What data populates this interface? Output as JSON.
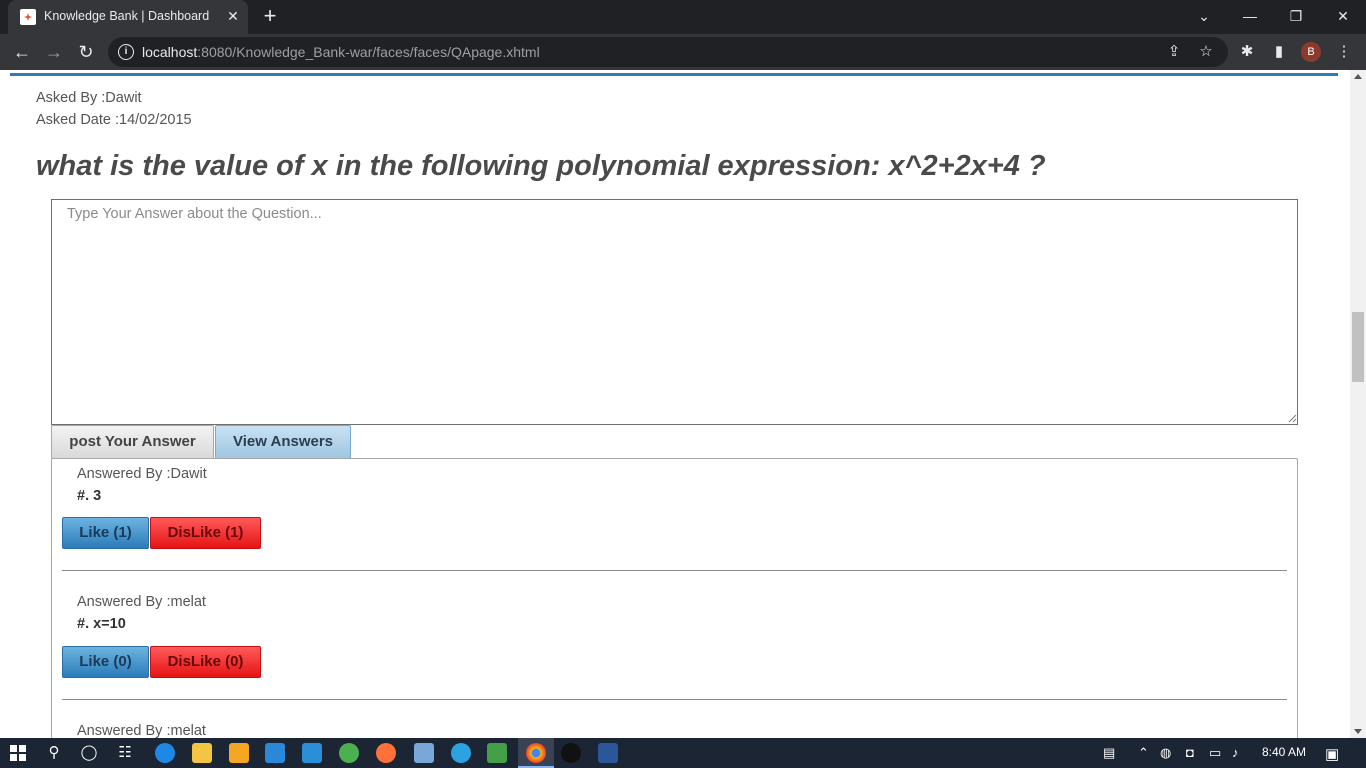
{
  "browser": {
    "tab_title": "Knowledge Bank | Dashboard",
    "tab_close": "✕",
    "new_tab": "+",
    "url_host": "localhost",
    "url_path": ":8080/Knowledge_Bank-war/faces/faces/QApage.xhtml",
    "profile_initial": "B",
    "window_controls": {
      "dropdown": "⌄",
      "minimize": "—",
      "restore": "❐",
      "close": "✕"
    }
  },
  "question": {
    "asked_by": "Asked By :Dawit",
    "asked_date": "Asked Date :14/02/2015",
    "text": "what is the value of x in the following polynomial expression: x^2+2x+4 ?"
  },
  "answer_form": {
    "placeholder": "Type Your Answer about the Question...",
    "post_label": "post Your Answer",
    "view_label": "View Answers"
  },
  "answers": [
    {
      "answered_by": "Answered By :Dawit",
      "text": "#. 3",
      "like": "Like (1)",
      "dislike": "DisLike (1)"
    },
    {
      "answered_by": "Answered By :melat",
      "text": "#. x=10",
      "like": "Like (0)",
      "dislike": "DisLike (0)"
    },
    {
      "answered_by": "Answered By :melat"
    }
  ],
  "taskbar": {
    "time": "8:40 AM"
  },
  "colors": {
    "accent_line": "#2f7db8",
    "like_button": "#2b7cba",
    "dislike_button": "#e51414"
  }
}
